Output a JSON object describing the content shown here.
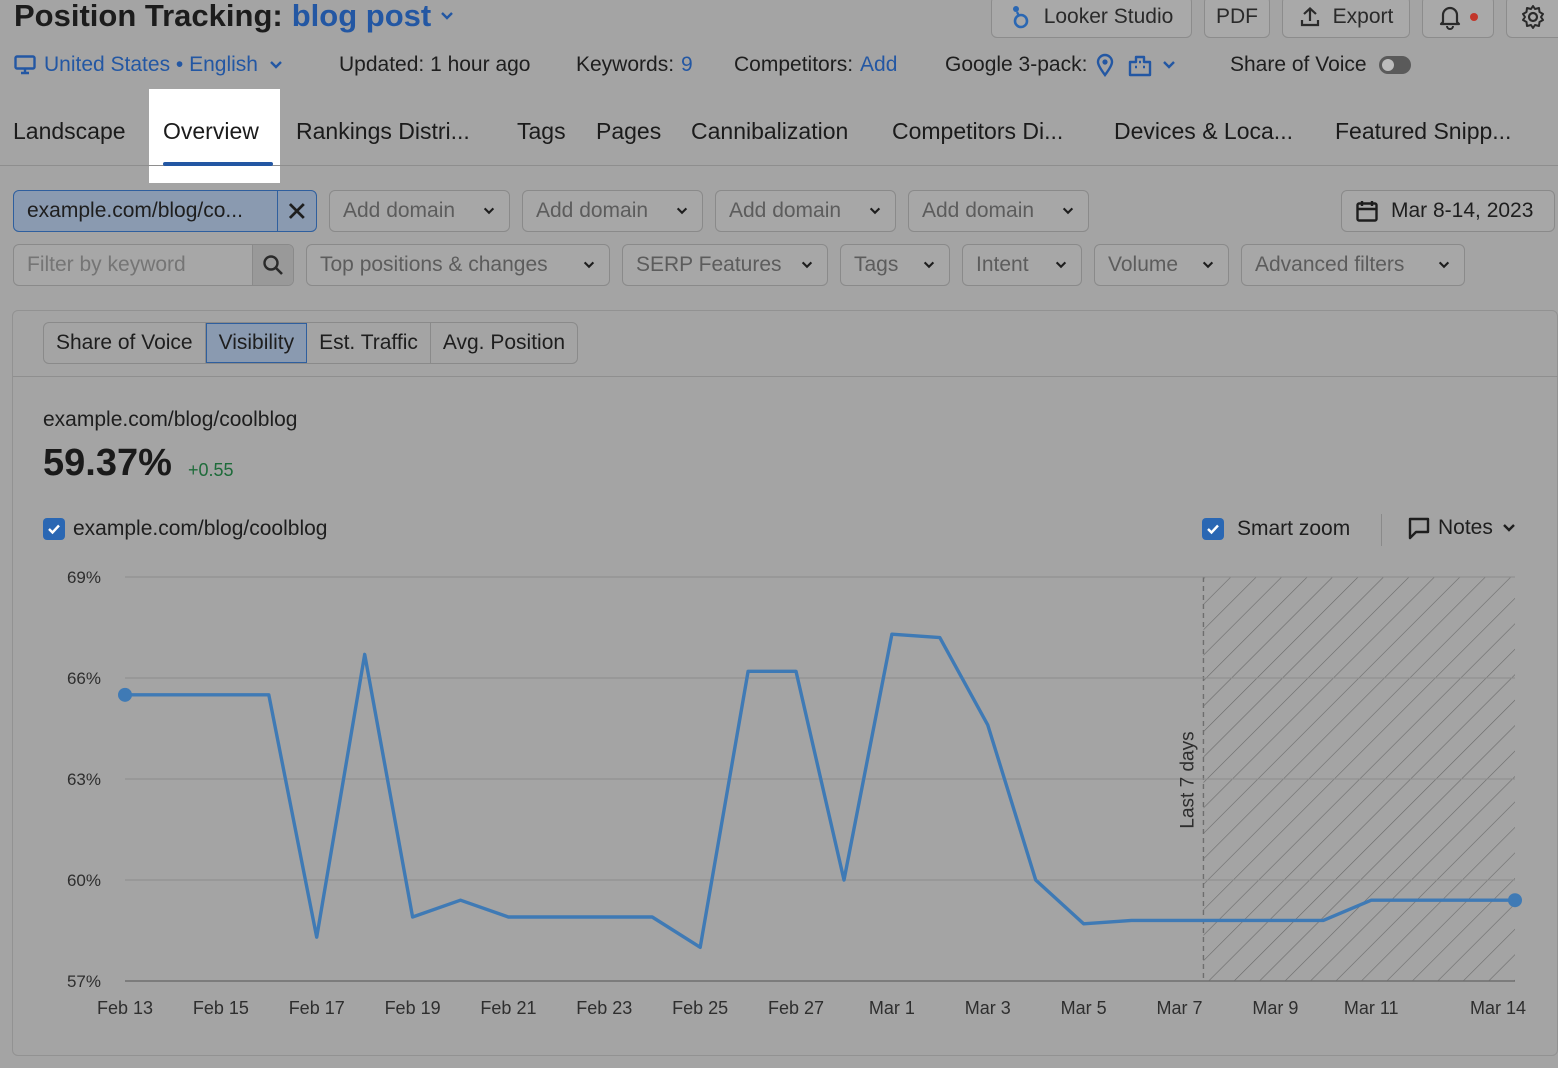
{
  "header": {
    "title": "Position Tracking:",
    "project": "blog post",
    "looker_label": "Looker Studio",
    "pdf_label": "PDF",
    "export_label": "Export"
  },
  "meta": {
    "location": "United States • English",
    "updated": "Updated: 1 hour ago",
    "keywords_label": "Keywords:",
    "keywords_count": "9",
    "competitors_label": "Competitors:",
    "competitors_add": "Add",
    "google_pack_label": "Google 3-pack:",
    "sov_label": "Share of Voice"
  },
  "tabs": [
    {
      "label": "Landscape"
    },
    {
      "label": "Overview"
    },
    {
      "label": "Rankings Distri..."
    },
    {
      "label": "Tags"
    },
    {
      "label": "Pages"
    },
    {
      "label": "Cannibalization"
    },
    {
      "label": "Competitors Di..."
    },
    {
      "label": "Devices & Loca..."
    },
    {
      "label": "Featured Snipp..."
    }
  ],
  "filters": {
    "domain_chip": "example.com/blog/co...",
    "add_domain_1": "Add domain",
    "add_domain_2": "Add domain",
    "add_domain_3": "Add domain",
    "add_domain_4": "Add domain",
    "date_range": "Mar 8-14, 2023",
    "keyword_placeholder": "Filter by keyword",
    "top_positions": "Top positions & changes",
    "serp_features": "SERP Features",
    "tags": "Tags",
    "intent": "Intent",
    "volume": "Volume",
    "advanced": "Advanced filters"
  },
  "card": {
    "segments": [
      "Share of Voice",
      "Visibility",
      "Est. Traffic",
      "Avg. Position"
    ],
    "domain": "example.com/blog/coolblog",
    "value": "59.37%",
    "delta": "+0.55",
    "legend_label": "example.com/blog/coolblog",
    "smart_zoom": "Smart zoom",
    "notes": "Notes"
  },
  "colors": {
    "accent": "#2357a3",
    "line": "#3f7ab5",
    "positive": "#1e6b3a"
  },
  "chart_data": {
    "type": "line",
    "x": [
      "Feb 13",
      "Feb 14",
      "Feb 15",
      "Feb 16",
      "Feb 17",
      "Feb 18",
      "Feb 19",
      "Feb 20",
      "Feb 21",
      "Feb 22",
      "Feb 23",
      "Feb 24",
      "Feb 25",
      "Feb 26",
      "Feb 27",
      "Feb 28",
      "Mar 1",
      "Mar 2",
      "Mar 3",
      "Mar 4",
      "Mar 5",
      "Mar 6",
      "Mar 7",
      "Mar 8",
      "Mar 9",
      "Mar 10",
      "Mar 11",
      "Mar 12",
      "Mar 13",
      "Mar 14"
    ],
    "xticks": [
      "Feb 13",
      "Feb 15",
      "Feb 17",
      "Feb 19",
      "Feb 21",
      "Feb 23",
      "Feb 25",
      "Feb 27",
      "Mar 1",
      "Mar 3",
      "Mar 5",
      "Mar 7",
      "Mar 9",
      "Mar 11",
      "Mar 14"
    ],
    "series": [
      {
        "name": "example.com/blog/coolblog",
        "values": [
          65.5,
          65.5,
          65.5,
          65.5,
          58.3,
          66.7,
          58.9,
          59.4,
          58.9,
          58.9,
          58.9,
          58.9,
          58.0,
          66.2,
          66.2,
          60.0,
          67.3,
          67.2,
          64.6,
          60.0,
          58.7,
          58.8,
          58.8,
          58.8,
          58.8,
          58.8,
          59.4,
          59.4,
          59.4,
          59.4
        ]
      }
    ],
    "yticks": [
      "57%",
      "60%",
      "63%",
      "66%",
      "69%"
    ],
    "ylim": [
      57,
      69
    ],
    "grid": true,
    "annotation": "Last 7 days",
    "shaded_from": "Mar 8"
  }
}
